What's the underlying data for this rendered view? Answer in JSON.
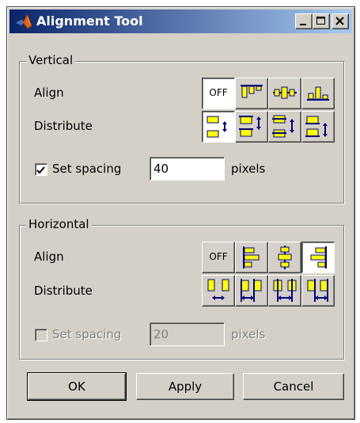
{
  "window": {
    "title": "Alignment Tool"
  },
  "vertical": {
    "group_label": "Vertical",
    "align_label": "Align",
    "distribute_label": "Distribute",
    "align_buttons": [
      {
        "label": "OFF",
        "icon": "align-off",
        "pressed": true
      },
      {
        "label": "",
        "icon": "align-top-icon",
        "pressed": false
      },
      {
        "label": "",
        "icon": "align-middle-icon",
        "pressed": false
      },
      {
        "label": "",
        "icon": "align-bottom-icon",
        "pressed": false
      }
    ],
    "distribute_buttons": [
      {
        "icon": "distribute-spacing-icon",
        "pressed": true
      },
      {
        "icon": "distribute-top-icon",
        "pressed": false
      },
      {
        "icon": "distribute-center-icon",
        "pressed": false
      },
      {
        "icon": "distribute-bottom-icon",
        "pressed": false
      }
    ],
    "set_spacing": {
      "label": "Set spacing",
      "checked": true,
      "enabled": true,
      "value": "40",
      "unit": "pixels"
    }
  },
  "horizontal": {
    "group_label": "Horizontal",
    "align_label": "Align",
    "distribute_label": "Distribute",
    "align_buttons": [
      {
        "label": "OFF",
        "icon": "align-off",
        "pressed": false
      },
      {
        "label": "",
        "icon": "align-left-icon",
        "pressed": false
      },
      {
        "label": "",
        "icon": "align-center-icon",
        "pressed": false
      },
      {
        "label": "",
        "icon": "align-right-icon",
        "pressed": true
      }
    ],
    "distribute_buttons": [
      {
        "icon": "distribute-spacing-icon",
        "pressed": false
      },
      {
        "icon": "distribute-left-icon",
        "pressed": false
      },
      {
        "icon": "distribute-center-icon",
        "pressed": false
      },
      {
        "icon": "distribute-right-icon",
        "pressed": false
      }
    ],
    "set_spacing": {
      "label": "Set spacing",
      "checked": false,
      "enabled": false,
      "value": "20",
      "unit": "pixels"
    }
  },
  "buttons": {
    "ok": "OK",
    "apply": "Apply",
    "cancel": "Cancel"
  },
  "colors": {
    "face": "#d4d0c8",
    "title_start": "#0a246a",
    "title_end": "#a6caf0",
    "icon_fill": "#ffff00",
    "icon_line": "#000080"
  }
}
